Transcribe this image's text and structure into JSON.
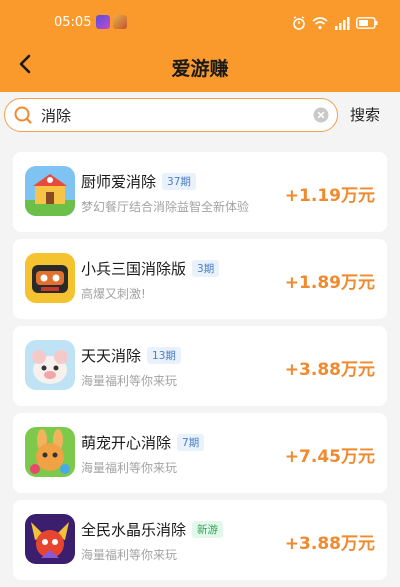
{
  "status": {
    "time": "05:05"
  },
  "nav": {
    "title": "爱游赚"
  },
  "search": {
    "value": "消除",
    "button_label": "搜索"
  },
  "games": [
    {
      "name": "厨师爱消除",
      "badge": "37期",
      "badge_style": "blue",
      "desc": "梦幻餐厅结合消除益智全新体验",
      "reward": "+1.19万元"
    },
    {
      "name": "小兵三国消除版",
      "badge": "3期",
      "badge_style": "blue",
      "desc": "高爆又刺激!",
      "reward": "+1.89万元"
    },
    {
      "name": "天天消除",
      "badge": "13期",
      "badge_style": "blue",
      "desc": "海量福利等你来玩",
      "reward": "+3.88万元"
    },
    {
      "name": "萌宠开心消除",
      "badge": "7期",
      "badge_style": "blue",
      "desc": "海量福利等你来玩",
      "reward": "+7.45万元"
    },
    {
      "name": "全民水晶乐消除",
      "badge": "新游",
      "badge_style": "green",
      "desc": "海量福利等你来玩",
      "reward": "+3.88万元"
    }
  ],
  "colors": {
    "header": "#fb9a2c",
    "accent": "#ef8a2e",
    "badge_blue": "#4a7fc6",
    "badge_green": "#2aa558"
  }
}
